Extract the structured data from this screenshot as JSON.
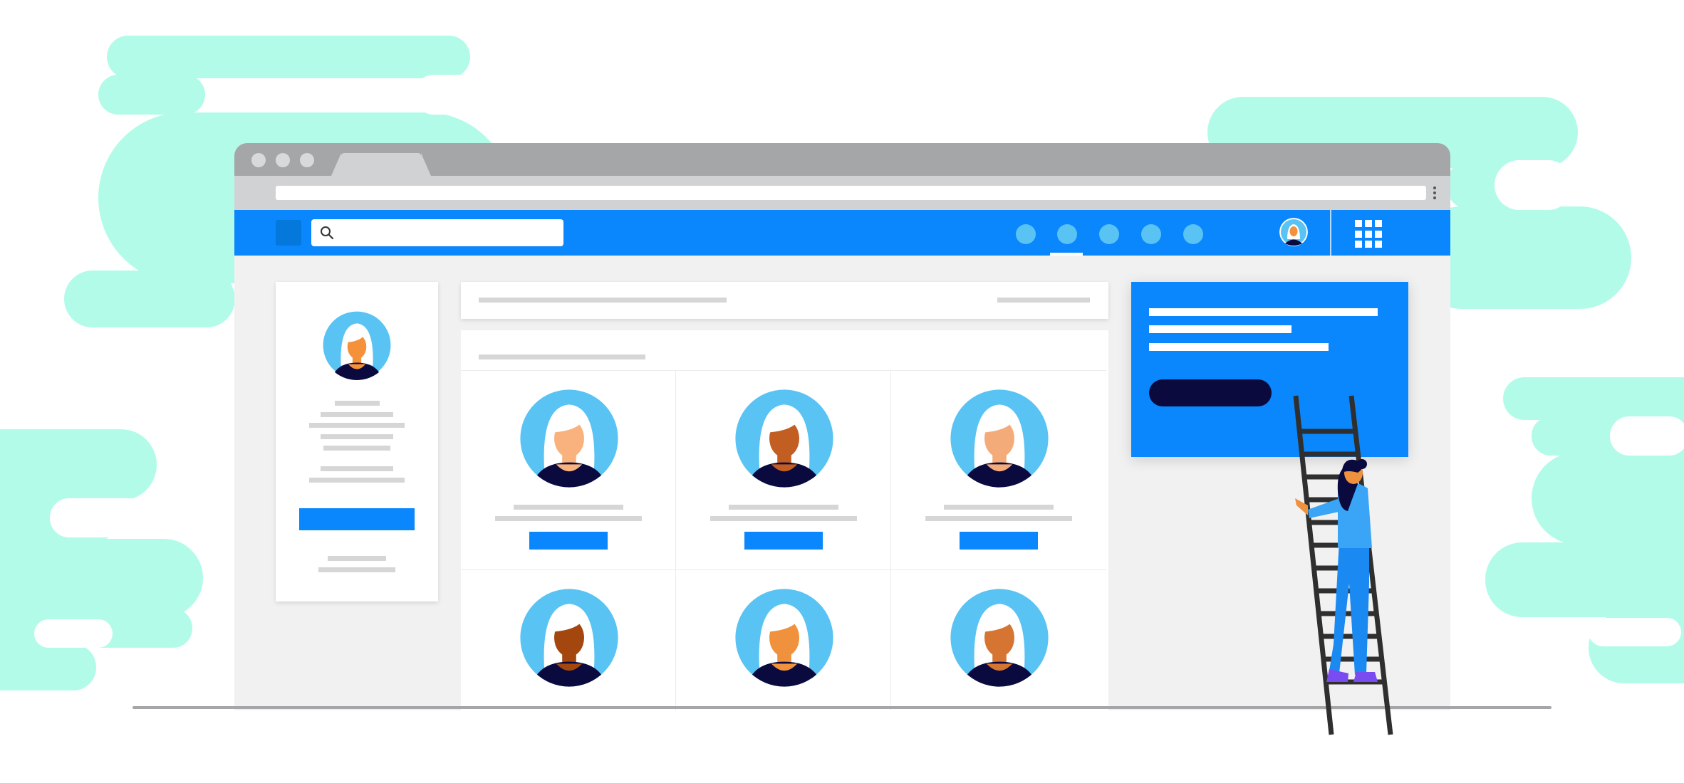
{
  "scene": {
    "background_color": "#ffffff",
    "cloud_color": "#b3fbe9"
  },
  "browser": {
    "chrome_color": "#a5a6a8",
    "toolbar_color": "#d1d2d4",
    "window_controls": [
      "dot",
      "dot",
      "dot"
    ],
    "tabs": 1
  },
  "app": {
    "brand_color": "#0a87fc",
    "accent_dark": "#0a0a3e",
    "search": {
      "placeholder": "",
      "icon": "search-icon"
    },
    "nav_items": [
      "nav-dot",
      "nav-dot",
      "nav-dot",
      "nav-dot",
      "nav-dot"
    ],
    "active_nav_index": 1,
    "user_avatar_icon": "avatar-icon",
    "apps_icon": "grid-icon"
  },
  "profile_card": {
    "avatar_icon": "avatar-icon",
    "button_label": ""
  },
  "people_grid": {
    "people": [
      {
        "skin": "#f9b27d",
        "hair": "#ffffff"
      },
      {
        "skin": "#c35e23",
        "hair": "#ffffff"
      },
      {
        "skin": "#f4ab7a",
        "hair": "#ffffff"
      },
      {
        "skin": "#a3470f",
        "hair": "#ffffff"
      },
      {
        "skin": "#f0913d",
        "hair": "#ffffff"
      },
      {
        "skin": "#d67532",
        "hair": "#ffffff"
      }
    ],
    "button_label": ""
  },
  "promo_card": {
    "button_label": ""
  },
  "figure": {
    "description_icon": "person-on-ladder-icon",
    "shirt": "#3aa4f6",
    "pants": "#1a8af2",
    "shoes": "#7a4cf0"
  }
}
